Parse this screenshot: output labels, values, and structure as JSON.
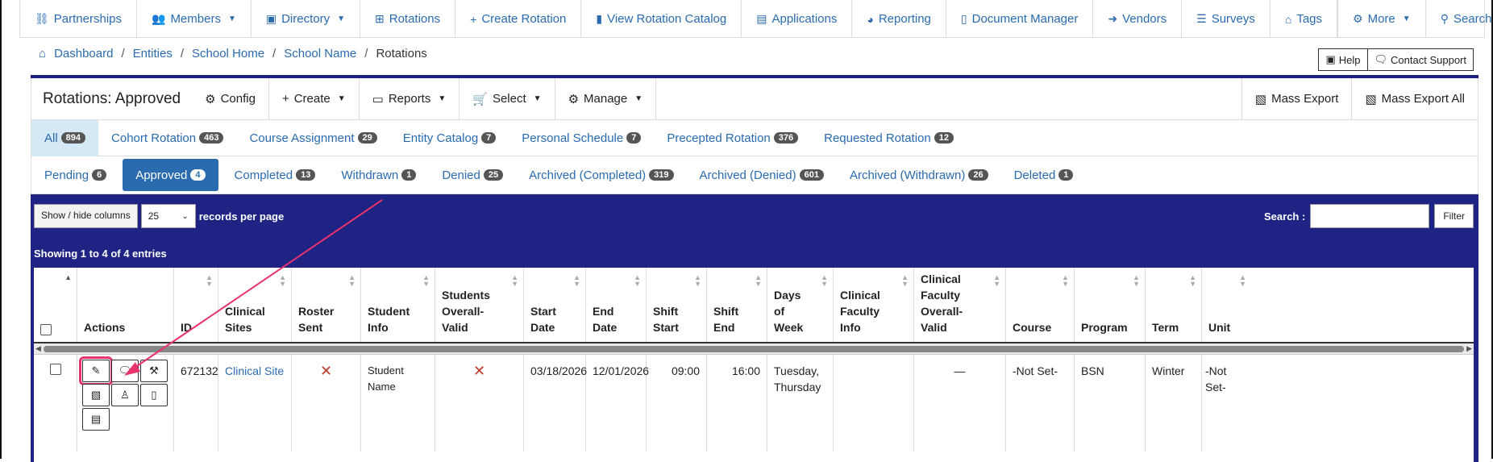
{
  "nav": {
    "items": [
      {
        "icon": "link-icon",
        "glyph": "⛓",
        "label": "Partnerships",
        "caret": false
      },
      {
        "icon": "members-icon",
        "glyph": "👥",
        "label": "Members",
        "caret": true
      },
      {
        "icon": "directory-icon",
        "glyph": "▣",
        "label": "Directory",
        "caret": true
      },
      {
        "icon": "table-icon",
        "glyph": "⊞",
        "label": "Rotations",
        "caret": false
      },
      {
        "icon": "plus-icon",
        "glyph": "+",
        "label": "Create Rotation",
        "caret": false
      },
      {
        "icon": "book-icon",
        "glyph": "▮",
        "label": "View Rotation Catalog",
        "caret": false
      },
      {
        "icon": "id-card-icon",
        "glyph": "▤",
        "label": "Applications",
        "caret": false
      },
      {
        "icon": "chart-icon",
        "glyph": "◕",
        "label": "Reporting",
        "caret": false
      },
      {
        "icon": "file-icon",
        "glyph": "▯",
        "label": "Document Manager",
        "caret": false
      },
      {
        "icon": "sign-out-icon",
        "glyph": "➜",
        "label": "Vendors",
        "caret": false
      },
      {
        "icon": "list-icon",
        "glyph": "☰",
        "label": "Surveys",
        "caret": false
      },
      {
        "icon": "tags-icon",
        "glyph": "⌂",
        "label": "Tags",
        "caret": false
      }
    ],
    "right": [
      {
        "icon": "gear-icon",
        "glyph": "⚙",
        "label": "More",
        "caret": true
      },
      {
        "icon": "search-icon",
        "glyph": "⚲",
        "label": "Search",
        "caret": true
      }
    ]
  },
  "breadcrumb": {
    "items": [
      "Dashboard",
      "Entities",
      "School Home",
      "School Name"
    ],
    "current": "Rotations"
  },
  "help": {
    "help_label": "Help",
    "support_label": "Contact Support"
  },
  "panel": {
    "title": "Rotations: Approved",
    "buttons": [
      {
        "name": "config",
        "glyph": "⚙",
        "label": "Config",
        "caret": false
      },
      {
        "name": "create",
        "glyph": "+",
        "label": "Create",
        "caret": true
      },
      {
        "name": "reports",
        "glyph": "▭",
        "label": "Reports",
        "caret": true
      },
      {
        "name": "select",
        "glyph": "🛒",
        "label": "Select",
        "caret": true
      },
      {
        "name": "manage",
        "glyph": "⚙",
        "label": "Manage",
        "caret": true
      }
    ],
    "exports": [
      {
        "name": "mass-export",
        "label": "Mass Export"
      },
      {
        "name": "mass-export-all",
        "label": "Mass Export All"
      }
    ]
  },
  "tabs1": [
    {
      "label": "All",
      "count": "894"
    },
    {
      "label": "Cohort Rotation",
      "count": "463"
    },
    {
      "label": "Course Assignment",
      "count": "29"
    },
    {
      "label": "Entity Catalog",
      "count": "7"
    },
    {
      "label": "Personal Schedule",
      "count": "7"
    },
    {
      "label": "Precepted Rotation",
      "count": "376"
    },
    {
      "label": "Requested Rotation",
      "count": "12"
    }
  ],
  "tabs2": [
    {
      "label": "Pending",
      "count": "6"
    },
    {
      "label": "Approved",
      "count": "4"
    },
    {
      "label": "Completed",
      "count": "13"
    },
    {
      "label": "Withdrawn",
      "count": "1"
    },
    {
      "label": "Denied",
      "count": "25"
    },
    {
      "label": "Archived (Completed)",
      "count": "319"
    },
    {
      "label": "Archived (Denied)",
      "count": "601"
    },
    {
      "label": "Archived (Withdrawn)",
      "count": "26"
    },
    {
      "label": "Deleted",
      "count": "1"
    }
  ],
  "table_ctrl": {
    "show_hide": "Show / hide columns",
    "rpp_value": "25",
    "rpp_text": "records per page",
    "search_label": "Search :",
    "filter": "Filter",
    "showing": "Showing 1 to 4 of 4 entries"
  },
  "columns": [
    "",
    "Actions",
    "ID",
    "Clinical Sites",
    "Roster Sent",
    "Student Info",
    "Students Overall-Valid",
    "Start Date",
    "End Date",
    "Shift Start",
    "Shift End",
    "Days of Week",
    "Clinical Faculty Info",
    "Clinical Faculty Overall-Valid",
    "Course",
    "Program",
    "Term",
    "Unit"
  ],
  "row": {
    "id": "672132",
    "site": "Clinical Site",
    "roster": "✕",
    "student": "Student Name",
    "valid": "✕",
    "start_date": "03/18/2026",
    "end_date": "12/01/2026",
    "shift_start": "09:00",
    "shift_end": "16:00",
    "days": "Tuesday, Thursday",
    "faculty_info": "",
    "faculty_valid": "—",
    "course": "-Not Set-",
    "program": "BSN",
    "term": "Winter",
    "unit": "-Not Set-"
  },
  "actions": [
    {
      "name": "edit-icon",
      "glyph": "✎"
    },
    {
      "name": "comments-icon",
      "glyph": "🗨"
    },
    {
      "name": "gavel-icon",
      "glyph": "⚒"
    },
    {
      "name": "file-export-icon",
      "glyph": "▧"
    },
    {
      "name": "user-graduate-icon",
      "glyph": "♙"
    },
    {
      "name": "document-icon",
      "glyph": "▯"
    },
    {
      "name": "clipboard-icon",
      "glyph": "▤"
    }
  ],
  "colors": {
    "accent": "#2a6bb0",
    "panel_blue": "#1e2384",
    "highlight": "#e8336d",
    "badge": "#555555"
  }
}
